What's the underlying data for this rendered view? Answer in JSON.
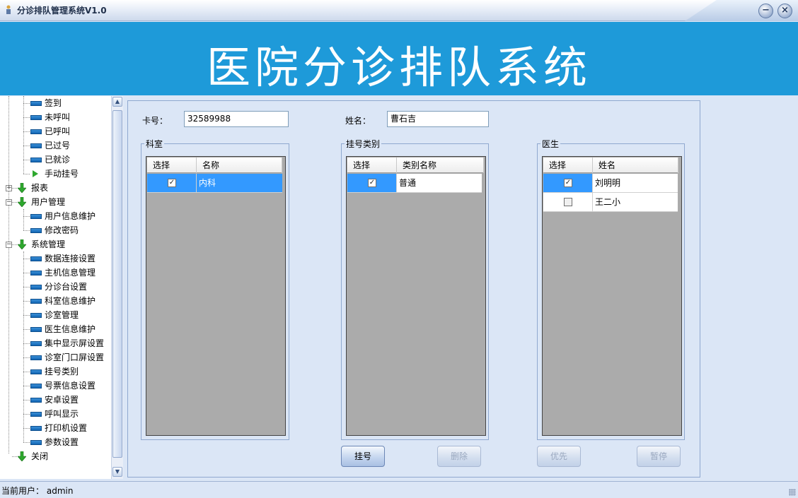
{
  "window": {
    "title": "分诊排队管理系统V1.0",
    "minimize_glyph": "−",
    "close_glyph": "×"
  },
  "banner": {
    "title": "医院分诊排队系统"
  },
  "sidebar": {
    "leaf_items_top": [
      "签到",
      "未呼叫",
      "已呼叫",
      "已过号",
      "已就诊"
    ],
    "manual_item": "手动挂号",
    "group_reports": "报表",
    "group_users": "用户管理",
    "user_items": [
      "用户信息维护",
      "修改密码"
    ],
    "group_system": "系统管理",
    "system_items": [
      "数据连接设置",
      "主机信息管理",
      "分诊台设置",
      "科室信息维护",
      "诊室管理",
      "医生信息维护",
      "集中显示屏设置",
      "诊室门口屏设置",
      "挂号类别",
      "号票信息设置",
      "安卓设置",
      "呼叫显示",
      "打印机设置",
      "参数设置"
    ],
    "close_item": "关闭",
    "scroll_up_glyph": "▲",
    "scroll_down_glyph": "▼"
  },
  "form": {
    "card_label": "卡号：",
    "card_value": "32589988",
    "name_label": "姓名：",
    "name_value": "曹石吉"
  },
  "dept": {
    "legend": "科室",
    "col_select": "选择",
    "col_name": "名称",
    "rows": [
      {
        "name": "内科",
        "checked": true
      }
    ]
  },
  "reg": {
    "legend": "挂号类别",
    "col_select": "选择",
    "col_name": "类别名称",
    "rows": [
      {
        "name": "普通",
        "checked": true
      }
    ]
  },
  "doctor": {
    "legend": "医生",
    "col_select": "选择",
    "col_name": "姓名",
    "rows": [
      {
        "name": "刘明明",
        "checked": true
      },
      {
        "name": "王二小",
        "checked": false
      }
    ]
  },
  "buttons": {
    "register": "挂号",
    "delete": "删除",
    "priority": "优先",
    "pause": "暂停"
  },
  "status": {
    "label": "当前用户：",
    "user": "admin"
  },
  "colors": {
    "banner": "#1e9ad9",
    "selection": "#3399ff",
    "background": "#dbe6f6"
  }
}
